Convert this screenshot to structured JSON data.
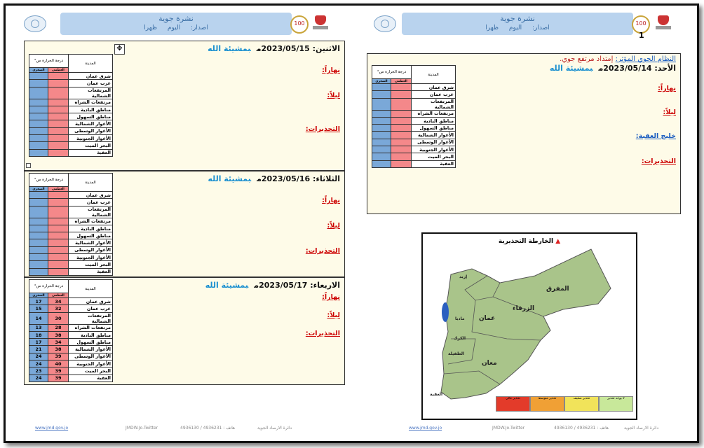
{
  "header": {
    "title": "نشرة جوية",
    "issue_label": "اصدار:",
    "issue_day": "اليوم",
    "issue_time": "ظهرا",
    "number": "1"
  },
  "table_headers": {
    "city": "المدينة",
    "temp": "درجة الحرارة س°",
    "max": "العظمى",
    "min": "الصغرى"
  },
  "cities": [
    "شرق عمان",
    "غرب عمان",
    "المرتفعات الشمالية",
    "مرتفعات الشراه",
    "مناطق البادية",
    "مناطق السهول",
    "الأغوار الشمالية",
    "الأغوار الوسطى",
    "الأغوار الجنوبية",
    "البحر الميت",
    "العقبة"
  ],
  "labels": {
    "day": "نهاراً:",
    "night": "ليلاً:",
    "warnings": "التحذيرات:",
    "gulf": "خليج العقبة:",
    "system": "النظام الجوي المؤثر:",
    "system_value": "إمتداد مرتفع جوي."
  },
  "blessing": "بمشيئة الله",
  "days_left": [
    {
      "title": "الاثنين: 2023/05/15م",
      "max": [
        "",
        "",
        "",
        "",
        "",
        "",
        "",
        "",
        "",
        "",
        ""
      ],
      "min": [
        "",
        "",
        "",
        "",
        "",
        "",
        "",
        "",
        "",
        "",
        ""
      ]
    },
    {
      "title": "الثلاثاء: 2023/05/16م",
      "max": [
        "",
        "",
        "",
        "",
        "",
        "",
        "",
        "",
        "",
        "",
        ""
      ],
      "min": [
        "",
        "",
        "",
        "",
        "",
        "",
        "",
        "",
        "",
        "",
        ""
      ]
    },
    {
      "title": "الاربعاء: 2023/05/17م",
      "max": [
        "34",
        "32",
        "30",
        "28",
        "38",
        "34",
        "38",
        "39",
        "40",
        "39",
        "39"
      ],
      "min": [
        "17",
        "15",
        "14",
        "13",
        "18",
        "17",
        "21",
        "24",
        "24",
        "23",
        "24"
      ]
    }
  ],
  "day_right": {
    "title": "الأحد: 2023/05/14م",
    "max": [
      "",
      "",
      "",
      "",
      "",
      "",
      "",
      "",
      "",
      "",
      ""
    ],
    "min": [
      "",
      "",
      "",
      "",
      "",
      "",
      "",
      "",
      "",
      "",
      ""
    ]
  },
  "map": {
    "title": "الخارطة التحذيرية",
    "regions": [
      "المفرق",
      "الزرقاء",
      "عمان",
      "معان",
      "الكرك",
      "الطفيلة",
      "العقبة",
      "مادبا",
      "إربد"
    ],
    "legend": [
      "لا يوجد تحذير",
      "تحذير ضعيف",
      "تحذير متوسط",
      "تحذير عالي"
    ],
    "legend_colors": [
      "#c8e89a",
      "#f1e35a",
      "#f0a035",
      "#e33b2a"
    ]
  },
  "footer": {
    "phone": "هاتف : 4936231 / 4936130",
    "fb": "دائرة الارصاد الجوية",
    "tw": "JMDW.Jo.Twitter",
    "site": "www.jmd.gov.jo"
  }
}
